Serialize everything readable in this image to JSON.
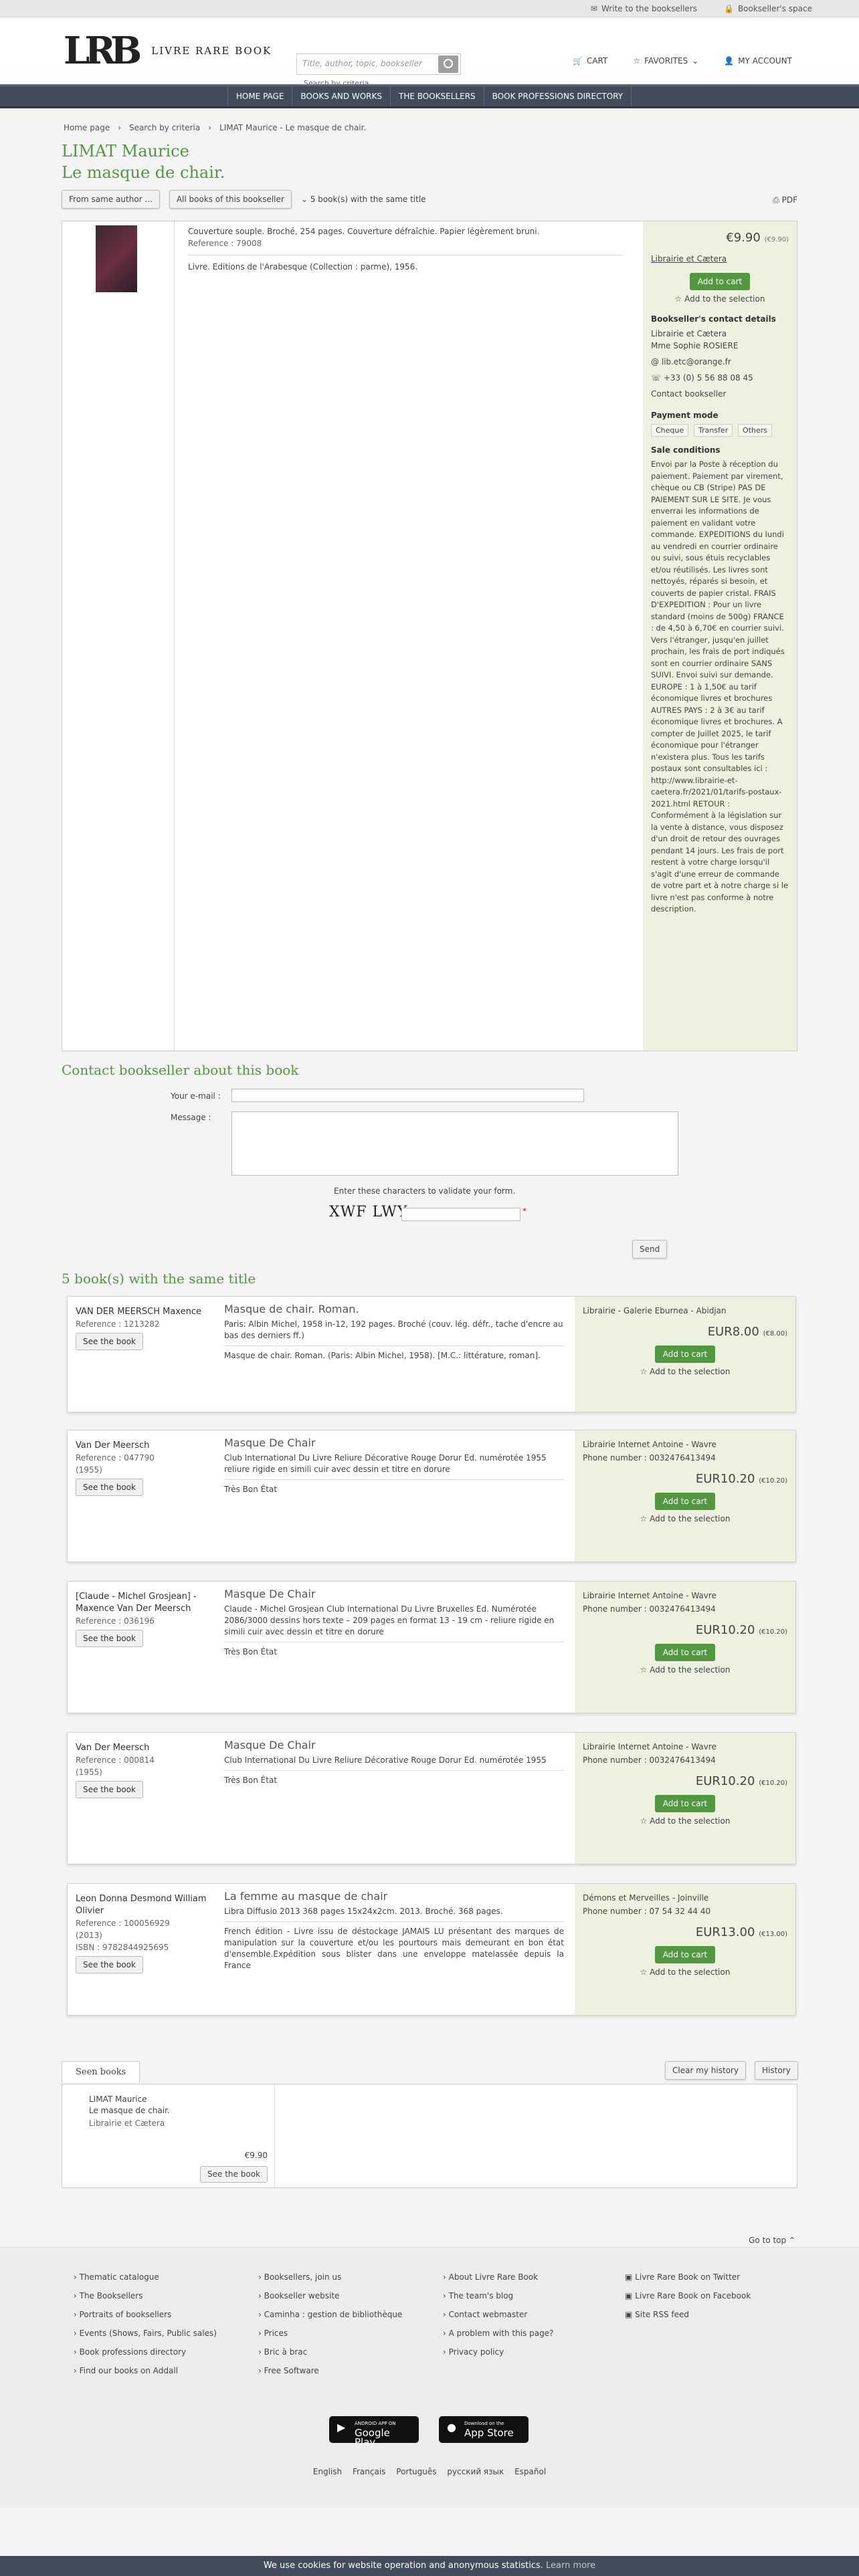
{
  "topbar": {
    "write": "Write to the booksellers",
    "space": "Bookseller's space"
  },
  "header": {
    "logo_mark": "LRB",
    "logo_text": "LIVRE RARE BOOK",
    "search_placeholder": "Title, author, topic, bookseller",
    "adv": "Search by criteria",
    "cart": "CART",
    "favorites": "FAVORITES",
    "account": "MY ACCOUNT"
  },
  "nav": [
    "HOME PAGE",
    "BOOKS AND WORKS",
    "THE BOOKSELLERS",
    "BOOK PROFESSIONS DIRECTORY"
  ],
  "crumbs": [
    "Home page",
    "Search by criteria",
    "LIMAT Maurice - Le masque de chair."
  ],
  "book": {
    "author": "LIMAT Maurice",
    "title": "Le masque de chair.",
    "from_author": "From same author ...",
    "all_books": "All books of this bookseller",
    "same_title": "5 book(s) with the same title",
    "pdf": "PDF",
    "d1": "Couverture souple. Broché, 254 pages. Couverture défraîchie. Papier légèrement bruni.",
    "ref": "Reference : 79008",
    "d2": "Livre. Editions de l'Arabesque (Collection : parme), 1956.",
    "price": "€9.90",
    "price_small": "(€9.90)",
    "seller": "Librairie et Cætera",
    "add": "Add to cart",
    "sel": "Add to the selection",
    "contact_h": "Bookseller's contact details",
    "c1": "Librairie et Cætera",
    "c2": "Mme Sophie ROSIERE",
    "email": "lib.etc@orange.fr",
    "phone": "+33 (0) 5 56 88 08 45",
    "contact": "Contact bookseller",
    "pay_h": "Payment mode",
    "pay": [
      "Cheque",
      "Transfer",
      "Others"
    ],
    "sale_h": "Sale conditions",
    "sale": "Envoi par la Poste à réception du paiement. Paiement par virement, chèque ou CB (Stripe) PAS DE PAIEMENT SUR LE SITE. Je vous enverrai les informations de paiement en validant votre commande. EXPEDITIONS du lundi au vendredi en courrier ordinaire ou suivi, sous étuis recyclables et/ou réutilisés. Les livres sont nettoyés, réparés si besoin, et couverts de papier cristal. FRAIS D'EXPEDITION : Pour un livre standard (moins de 500g) FRANCE : de 4,50 à 6,70€ en courrier suivi. Vers l'étranger, jusqu'en juillet prochain, les frais de port indiqués sont en courrier ordinaire SANS SUIVI. Envoi suivi sur demande. EUROPE : 1 à 1,50€ au tarif économique livres et brochures AUTRES PAYS : 2 à 3€ au tarif économique livres et brochures. A compter de Juillet 2025, le tarif économique pour l'étranger n'existera plus. Tous les tarifs postaux sont consultables ici : http://www.librairie-et-caetera.fr/2021/01/tarifs-postaux-2021.html RETOUR : Conformément à la législation sur la vente à distance, vous disposez d'un droit de retour des ouvrages pendant 14 jours. Les frais de port restent à votre charge lorsqu'il s'agit d'une erreur de commande de votre part et à notre charge si le livre n'est pas conforme à notre description."
  },
  "contact": {
    "title": "Contact bookseller about this book",
    "email": "Your e-mail :",
    "message": "Message :",
    "validate": "Enter these characters to validate your form.",
    "captcha": "XWF LWY",
    "send": "Send"
  },
  "same": {
    "title": "5 book(s) with the same title",
    "items": [
      {
        "a": "VAN DER MEERSCH Maxence",
        "r": "Reference : 1213282",
        "y": "",
        "t": "Masque de chair. Roman.",
        "d1": "Paris: Albin Michel, 1958 in-12, 192 pages. Broché (couv. lég. défr., tache d'encre au bas des derniers ff.)",
        "d2": "Masque de chair. Roman. (Paris: Albin Michel, 1958). [M.C.: littérature, roman].",
        "s": "Librairie - Galerie Eburnea - Abidjan",
        "ph": "",
        "p": "EUR8.00",
        "ps": "(€8.00)"
      },
      {
        "a": "Van Der Meersch",
        "r": "Reference : 047790",
        "y": "(1955)",
        "t": "Masque De Chair",
        "d1": "Club International Du Livre Reliure Décorative Rouge Dorur Ed. numérotée 1955 reliure rigide en simili cuir avec dessin et titre en dorure",
        "d2": "Très Bon État",
        "s": "Librairie Internet Antoine - Wavre",
        "ph": "Phone number : 0032476413494",
        "p": "EUR10.20",
        "ps": "(€10.20)"
      },
      {
        "a": "[Claude - Michel Grosjean] - Maxence Van Der Meersch",
        "r": "Reference : 036196",
        "y": "",
        "t": "Masque De Chair",
        "d1": "Claude - Michel Grosjean Club International Du Livre Bruxelles Ed. Numérotée 2086/3000 dessins hors texte – 209 pages en format 13 - 19 cm - reliure rigide en simili cuir avec dessin et titre en dorure",
        "d2": "Très Bon État",
        "s": "Librairie Internet Antoine - Wavre",
        "ph": "Phone number : 0032476413494",
        "p": "EUR10.20",
        "ps": "(€10.20)"
      },
      {
        "a": "Van Der Meersch",
        "r": "Reference : 000814",
        "y": "(1955)",
        "t": "Masque De Chair",
        "d1": "Club International Du Livre Reliure Décorative Rouge Dorur Ed. numérotée 1955",
        "d2": "Très Bon État",
        "s": "Librairie Internet Antoine - Wavre",
        "ph": "Phone number : 0032476413494",
        "p": "EUR10.20",
        "ps": "(€10.20)"
      },
      {
        "a": "Leon Donna Desmond William Olivier",
        "r": "Reference : 100056929",
        "y": "(2013)",
        "t": "La femme au masque de chair",
        "d1": "Libra Diffusio 2013 368 pages 15x24x2cm. 2013. Broché. 368 pages.",
        "d2": "French édition - Livre issu de déstockage JAMAIS LU présentant des marques de manipulation sur la couverture et/ou les pourtours mais demeurant en bon état d'ensemble.Expédition sous blister dans une enveloppe matelassée depuis la France",
        "s": "Démons et Merveilles - Joinville",
        "ph": "Phone number : 07 54 32 44 40",
        "p": "EUR13.00",
        "ps": "(€13.00)",
        "isbn": "ISBN : 9782844925695"
      }
    ],
    "see": "See the book",
    "add": "Add to cart",
    "sel": "Add to the selection"
  },
  "seen": {
    "tab": "Seen books",
    "clear": "Clear my history",
    "history": "History",
    "a": "LIMAT Maurice",
    "t": "Le masque de chair.",
    "s": "Librairie et Cætera",
    "p": "€9.90",
    "see": "See the book"
  },
  "footer": {
    "goto": "Go to top",
    "c1": [
      "Thematic catalogue",
      "The Booksellers",
      "Portraits of booksellers",
      "Events (Shows, Fairs, Public sales)",
      "Book professions directory",
      "Find our books on Addall"
    ],
    "c2": [
      "Booksellers, join us",
      "Bookseller website",
      "Caminha : gestion de bibliothèque",
      "Prices",
      "Bric à brac",
      "Free Software"
    ],
    "c3": [
      "About Livre Rare Book",
      "The team's blog",
      "Contact webmaster",
      "A problem with this page?",
      "Privacy policy"
    ],
    "c4": [
      "Livre Rare Book on Twitter",
      "Livre Rare Book on Facebook",
      "Site RSS feed"
    ],
    "gp": "Google Play",
    "gp_small": "ANDROID APP ON",
    "as": "App Store",
    "as_small": "Download on the",
    "langs": [
      "English",
      "Français",
      "Português",
      "русский язык",
      "Español"
    ]
  },
  "cookie": {
    "text": "We use cookies for website operation and anonymous statistics.",
    "learn": "Learn more"
  }
}
